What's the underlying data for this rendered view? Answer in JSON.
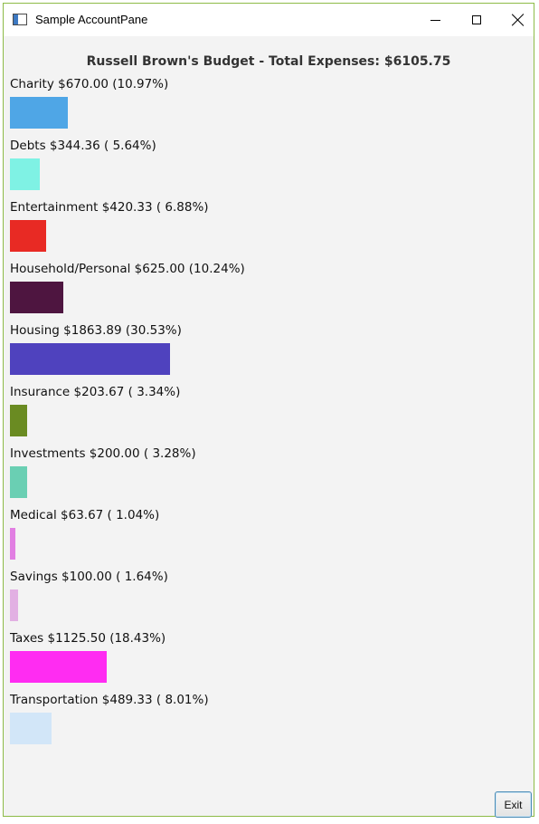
{
  "window": {
    "title": "Sample AccountPane",
    "controls": {
      "minimize": "minimize-icon",
      "maximize": "maximize-icon",
      "close": "close-icon"
    },
    "border_color": "#8dbb47"
  },
  "header": {
    "title": "Russell Brown's Budget - Total Expenses: $6105.75"
  },
  "chart_data": {
    "type": "bar",
    "orientation": "horizontal",
    "categories": [
      "Charity",
      "Debts",
      "Entertainment",
      "Household/Personal",
      "Housing",
      "Insurance",
      "Investments",
      "Medical",
      "Savings",
      "Taxes",
      "Transportation"
    ],
    "values": [
      670.0,
      344.36,
      420.33,
      625.0,
      1863.89,
      203.67,
      200.0,
      63.67,
      100.0,
      1125.5,
      489.33
    ],
    "percents": [
      10.97,
      5.64,
      6.88,
      10.24,
      30.53,
      3.34,
      3.28,
      1.04,
      1.64,
      18.43,
      8.01
    ],
    "total": 6105.75
  },
  "items": [
    {
      "label": "Charity $670.00 (10.97%)",
      "amount": 670.0,
      "color": "#4fa6e6"
    },
    {
      "label": "Debts $344.36 ( 5.64%)",
      "amount": 344.36,
      "color": "#7ff2e4"
    },
    {
      "label": "Entertainment $420.33 ( 6.88%)",
      "amount": 420.33,
      "color": "#e82a24"
    },
    {
      "label": "Household/Personal $625.00 (10.24%)",
      "amount": 625.0,
      "color": "#4e1540"
    },
    {
      "label": "Housing $1863.89 (30.53%)",
      "amount": 1863.89,
      "color": "#4f42be"
    },
    {
      "label": "Insurance $203.67 ( 3.34%)",
      "amount": 203.67,
      "color": "#6a8b22"
    },
    {
      "label": "Investments $200.00 ( 3.28%)",
      "amount": 200.0,
      "color": "#6acfb3"
    },
    {
      "label": "Medical $63.67 ( 1.04%)",
      "amount": 63.67,
      "color": "#e17fe2"
    },
    {
      "label": "Savings $100.00 ( 1.64%)",
      "amount": 100.0,
      "color": "#e2b0e3"
    },
    {
      "label": "Taxes $1125.50 (18.43%)",
      "amount": 1125.5,
      "color": "#ff2cf2"
    },
    {
      "label": "Transportation $489.33 ( 8.01%)",
      "amount": 489.33,
      "color": "#d2e6f8"
    }
  ],
  "buttons": {
    "exit_label": "Exit"
  }
}
